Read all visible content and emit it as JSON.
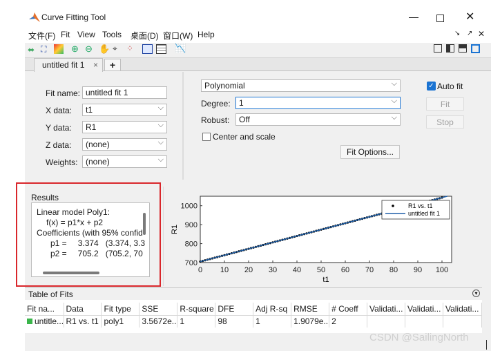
{
  "window": {
    "title": "Curve Fitting Tool"
  },
  "menu": [
    "文件(F)",
    "Fit",
    "View",
    "Tools",
    "桌面(D)",
    "窗口(W)",
    "Help"
  ],
  "toolbar_icons": [
    "pan-icon",
    "data-cursor-icon",
    "colormap-icon",
    "zoom-in-icon",
    "zoom-out-icon",
    "hand-icon",
    "data-tip-icon",
    "outliers-icon",
    "legend-icon",
    "grid-icon",
    "residuals-icon"
  ],
  "tab": {
    "label": "untitled fit 1",
    "close": "×",
    "add": "+"
  },
  "data_panel": {
    "fit_name_label": "Fit name:",
    "fit_name": "untitled fit 1",
    "xdata_label": "X data:",
    "xdata": "t1",
    "ydata_label": "Y data:",
    "ydata": "R1",
    "zdata_label": "Z data:",
    "zdata": "(none)",
    "weights_label": "Weights:",
    "weights": "(none)"
  },
  "fit_panel": {
    "model": "Polynomial",
    "degree_label": "Degree:",
    "degree": "1",
    "robust_label": "Robust:",
    "robust": "Off",
    "center_scale_label": "Center and scale",
    "fit_options_label": "Fit Options...",
    "auto_fit_label": "Auto fit",
    "fit_label": "Fit",
    "stop_label": "Stop"
  },
  "results": {
    "title": "Results",
    "lines": [
      "Linear model Poly1:",
      "f(x) = p1*x + p2",
      "Coefficients (with 95% confid",
      "p1 =",
      "p2 ="
    ],
    "p1_val": "3.374",
    "p1_ci": "(3.374, 3.3",
    "p2_val": "705.2",
    "p2_ci": "(705.2, 70"
  },
  "chart_data": {
    "type": "scatter",
    "xlabel": "t1",
    "ylabel": "R1",
    "xlim": [
      0,
      104
    ],
    "ylim": [
      700,
      1050
    ],
    "xticks": [
      0,
      10,
      20,
      30,
      40,
      50,
      60,
      70,
      80,
      90,
      100
    ],
    "yticks": [
      700,
      800,
      900,
      1000
    ],
    "series": [
      {
        "name": "R1 vs. t1",
        "kind": "points",
        "x": [
          0,
          10,
          20,
          30,
          40,
          50,
          60,
          70,
          80,
          90,
          100
        ],
        "y": [
          705.2,
          738.9,
          772.7,
          806.4,
          840.2,
          873.9,
          907.6,
          941.4,
          975.1,
          1008.9,
          1042.6
        ]
      },
      {
        "name": "untitled fit 1",
        "kind": "line",
        "x": [
          0,
          104
        ],
        "y": [
          705.2,
          1056.1
        ]
      }
    ],
    "legend": "top-right",
    "colors": {
      "points": "#000000",
      "line": "#1f5fa8"
    }
  },
  "table_of_fits": {
    "title": "Table of Fits",
    "columns": [
      "Fit na...",
      "Data",
      "Fit type",
      "SSE",
      "R-square",
      "DFE",
      "Adj R-sq",
      "RMSE",
      "# Coeff",
      "Validati...",
      "Validati...",
      "Validati..."
    ],
    "rows": [
      [
        "untitle...",
        "R1 vs. t1",
        "poly1",
        "3.5672e...",
        "1",
        "98",
        "1",
        "1.9079e...",
        "2",
        "",
        "",
        ""
      ]
    ]
  },
  "watermark": "CSDN @SailingNorth",
  "accent": "#1a73d2",
  "highlight_color": "#d9262b"
}
